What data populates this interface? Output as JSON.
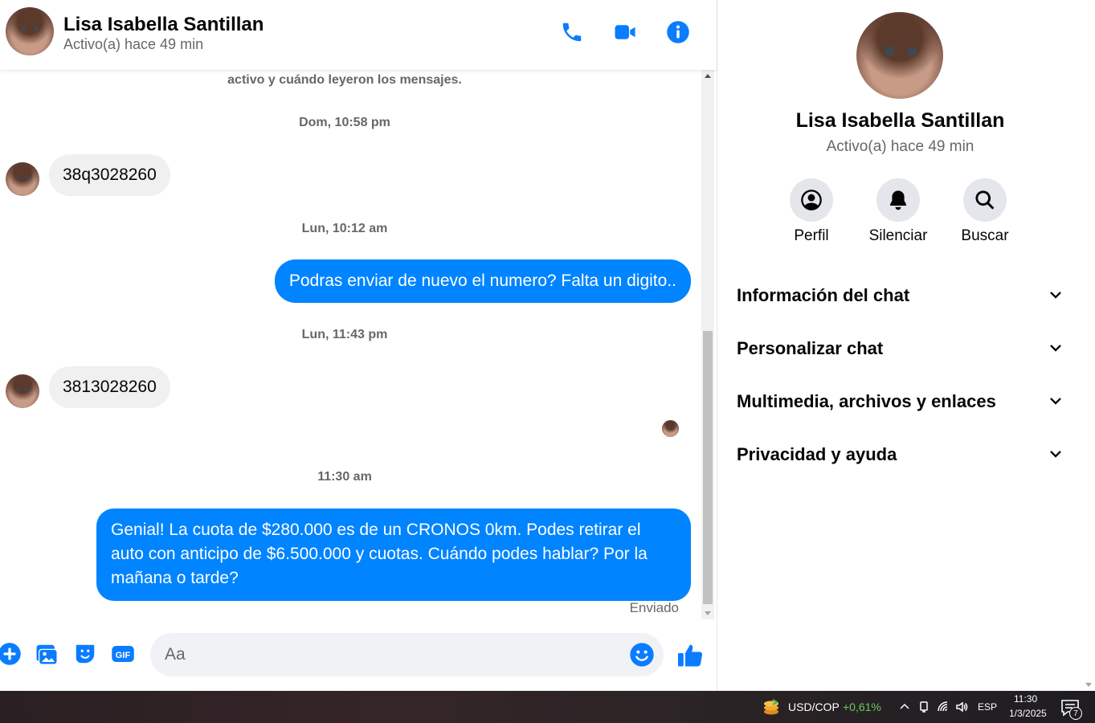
{
  "chat_header": {
    "name": "Lisa Isabella Santillan",
    "status": "Activo(a) hace 49 min",
    "icons": [
      "phone-icon",
      "video-call-icon",
      "info-icon"
    ]
  },
  "messages": {
    "system_note": "activo y cuándo leyeron los mensajes.",
    "items": [
      {
        "type": "timestamp",
        "text": "Dom, 10:58 pm"
      },
      {
        "type": "incoming",
        "text": "38q3028260"
      },
      {
        "type": "timestamp",
        "text": "Lun, 10:12 am"
      },
      {
        "type": "outgoing",
        "text": "Podras enviar de nuevo el numero? Falta un digito.."
      },
      {
        "type": "timestamp",
        "text": "Lun, 11:43 pm"
      },
      {
        "type": "incoming",
        "text": "3813028260"
      },
      {
        "type": "timestamp",
        "text": "11:30 am"
      },
      {
        "type": "outgoing",
        "text": "Genial! La cuota de $280.000 es de un CRONOS 0km. Podes retirar el auto con anticipo de $6.500.000 y cuotas. Cuándo podes hablar? Por la mañana o tarde?"
      }
    ],
    "sent_status": "Enviado"
  },
  "composer": {
    "placeholder": "Aa",
    "icons": [
      "plus-icon",
      "photo-icon",
      "sticker-icon",
      "gif-icon",
      "emoji-icon",
      "like-icon"
    ],
    "gif_label": "GIF"
  },
  "info_panel": {
    "name": "Lisa Isabella Santillan",
    "status": "Activo(a) hace 49 min",
    "actions": [
      {
        "label": "Perfil",
        "icon": "profile-icon"
      },
      {
        "label": "Silenciar",
        "icon": "bell-icon"
      },
      {
        "label": "Buscar",
        "icon": "search-icon"
      }
    ],
    "sections": [
      "Información del chat",
      "Personalizar chat",
      "Multimedia, archivos y enlaces",
      "Privacidad y ayuda"
    ]
  },
  "taskbar": {
    "currency": "USD/COP",
    "change": "+0,61%",
    "change_color": "#6ccb5f",
    "language": "ESP",
    "time": "11:30",
    "date": "1/3/2025",
    "notification_count": "7"
  },
  "colors": {
    "accent": "#0a7cff",
    "outgoing_bubble": "#0084ff",
    "incoming_bubble": "#f0f0f0"
  }
}
